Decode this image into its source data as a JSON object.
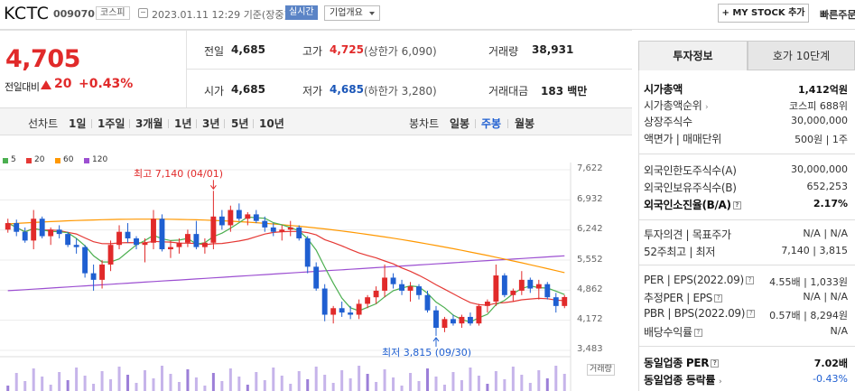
{
  "header": {
    "name": "KCTC",
    "code": "009070",
    "market": "코스피",
    "datetime": "2023.01.11 12:29",
    "basis": "기준(장중)",
    "live": "실시간",
    "corp_info": "기업개요",
    "mystock": "+ MY STOCK 추가",
    "quick": "빠른주문"
  },
  "quote": {
    "price": "4,705",
    "change_label": "전일대비",
    "change": "20",
    "change_pct": "+0.43%",
    "prev_label": "전일",
    "prev": "4,685",
    "high_label": "고가",
    "high": "4,725",
    "upper_label": "(상한가 6,090)",
    "volume_label": "거래량",
    "volume": "38,931",
    "open_label": "시가",
    "open": "4,685",
    "low_label": "저가",
    "low": "4,685",
    "lower_label": "(하한가 3,280)",
    "amount_label": "거래대금",
    "amount": "183 백만"
  },
  "periods": {
    "line_label": "선차트",
    "items": [
      "1일",
      "1주일",
      "3개월",
      "1년",
      "3년",
      "5년",
      "10년"
    ],
    "candle_label": "봉차트",
    "candle_items": [
      "일봉",
      "주봉",
      "월봉"
    ],
    "selected": "주봉"
  },
  "colors": {
    "up": "#e12a2a",
    "down": "#1f5fd1",
    "ma5": "#4caf50",
    "ma20": "#e53935",
    "ma60": "#ff9800",
    "ma120": "#9c4fd1"
  },
  "chart_data": {
    "type": "candlestick",
    "interval": "weekly",
    "legend": [
      "5",
      "20",
      "60",
      "120"
    ],
    "y_ticks": [
      "7,622",
      "6,932",
      "6,242",
      "5,552",
      "4,862",
      "4,172",
      "3,483"
    ],
    "ylim": [
      3483,
      7622
    ],
    "volume_label": "거래량",
    "high_annotation": "최고 7,140 (04/01)",
    "low_annotation": "최저 3,815 (09/30)",
    "candles": [
      [
        6250,
        6500,
        6180,
        6400
      ],
      [
        6400,
        6480,
        6100,
        6200
      ],
      [
        6200,
        6300,
        5950,
        6000
      ],
      [
        6000,
        6700,
        5800,
        6500
      ],
      [
        6500,
        6550,
        6050,
        6100
      ],
      [
        6100,
        6300,
        5900,
        6250
      ],
      [
        6250,
        6350,
        6050,
        6150
      ],
      [
        6150,
        6200,
        5850,
        5900
      ],
      [
        5900,
        6050,
        5700,
        5850
      ],
      [
        5850,
        5900,
        5150,
        5250
      ],
      [
        5250,
        5450,
        4850,
        5100
      ],
      [
        5100,
        5550,
        4900,
        5450
      ],
      [
        5450,
        6000,
        5300,
        5900
      ],
      [
        5900,
        6350,
        5800,
        6200
      ],
      [
        6200,
        6400,
        5950,
        6050
      ],
      [
        6050,
        6100,
        5800,
        5900
      ],
      [
        5900,
        6050,
        5500,
        5950
      ],
      [
        5950,
        6700,
        5800,
        6500
      ],
      [
        6500,
        6600,
        5750,
        5800
      ],
      [
        5800,
        6000,
        5600,
        5850
      ],
      [
        5850,
        6050,
        5700,
        5950
      ],
      [
        5950,
        6250,
        5850,
        6150
      ],
      [
        6150,
        6450,
        5800,
        5850
      ],
      [
        5850,
        6050,
        5700,
        5950
      ],
      [
        5950,
        7140,
        5800,
        6550
      ],
      [
        6550,
        6700,
        6250,
        6350
      ],
      [
        6350,
        6800,
        6200,
        6700
      ],
      [
        6700,
        6850,
        6450,
        6500
      ],
      [
        6500,
        6650,
        6350,
        6600
      ],
      [
        6600,
        6700,
        6400,
        6450
      ],
      [
        6450,
        6550,
        6200,
        6300
      ],
      [
        6300,
        6400,
        6100,
        6200
      ],
      [
        6200,
        6350,
        6000,
        6250
      ],
      [
        6250,
        6450,
        6100,
        6300
      ],
      [
        6300,
        6350,
        6000,
        6050
      ],
      [
        6050,
        6100,
        5250,
        5400
      ],
      [
        5400,
        5500,
        4850,
        4900
      ],
      [
        4900,
        5000,
        4150,
        4300
      ],
      [
        4300,
        4500,
        4100,
        4450
      ],
      [
        4450,
        4600,
        4250,
        4350
      ],
      [
        4350,
        4500,
        4200,
        4300
      ],
      [
        4300,
        4650,
        4200,
        4550
      ],
      [
        4550,
        4750,
        4450,
        4700
      ],
      [
        4700,
        4950,
        4550,
        4850
      ],
      [
        4850,
        5450,
        4700,
        5150
      ],
      [
        5150,
        5250,
        4900,
        5000
      ],
      [
        5000,
        5100,
        4750,
        4850
      ],
      [
        4850,
        5050,
        4600,
        4950
      ],
      [
        4950,
        5000,
        4650,
        4750
      ],
      [
        4750,
        4850,
        4350,
        4400
      ],
      [
        4400,
        4500,
        3815,
        4000
      ],
      [
        4000,
        4250,
        3900,
        4200
      ],
      [
        4200,
        4300,
        4050,
        4100
      ],
      [
        4100,
        4300,
        4000,
        4250
      ],
      [
        4250,
        4350,
        4050,
        4100
      ],
      [
        4100,
        4550,
        4050,
        4500
      ],
      [
        4500,
        4650,
        4350,
        4600
      ],
      [
        4600,
        5450,
        4500,
        5200
      ],
      [
        5200,
        5250,
        4700,
        4750
      ],
      [
        4750,
        4900,
        4600,
        4850
      ],
      [
        4850,
        5300,
        4750,
        5100
      ],
      [
        5100,
        5150,
        4800,
        4900
      ],
      [
        4900,
        5100,
        4650,
        5000
      ],
      [
        5000,
        5050,
        4650,
        4700
      ],
      [
        4700,
        4800,
        4350,
        4500
      ],
      [
        4500,
        4750,
        4450,
        4705
      ]
    ]
  },
  "side": {
    "tab_invest": "투자정보",
    "tab_quote": "호가 10단계",
    "rows": [
      {
        "label": "시가총액",
        "value": "1,412억원",
        "bold": true
      },
      {
        "label": "시가총액순위",
        "value": "코스피 688위"
      },
      {
        "label": "상장주식수",
        "value": "30,000,000"
      },
      {
        "label": "액면가 | 매매단위",
        "value": "500원 | 1주"
      },
      {
        "label": "외국인한도주식수(A)",
        "value": "30,000,000"
      },
      {
        "label": "외국인보유주식수(B)",
        "value": "652,253"
      },
      {
        "label": "외국인소진율(B/A)",
        "value": "2.17%",
        "bold": true
      },
      {
        "label": "투자의견 | 목표주가",
        "value": "N/A | N/A"
      },
      {
        "label": "52주최고 | 최저",
        "value": "7,140 | 3,815"
      },
      {
        "label": "PER | EPS(2022.09)",
        "value": "4.55배 | 1,033원"
      },
      {
        "label": "추정PER | EPS",
        "value": "N/A | N/A"
      },
      {
        "label": "PBR | BPS(2022.09)",
        "value": "0.57배 | 8,294원"
      },
      {
        "label": "배당수익률",
        "value": "N/A"
      },
      {
        "label": "동일업종 PER",
        "value": "7.02배",
        "bold": true
      },
      {
        "label": "동일업종 등락률",
        "value": "-0.43%"
      }
    ]
  }
}
